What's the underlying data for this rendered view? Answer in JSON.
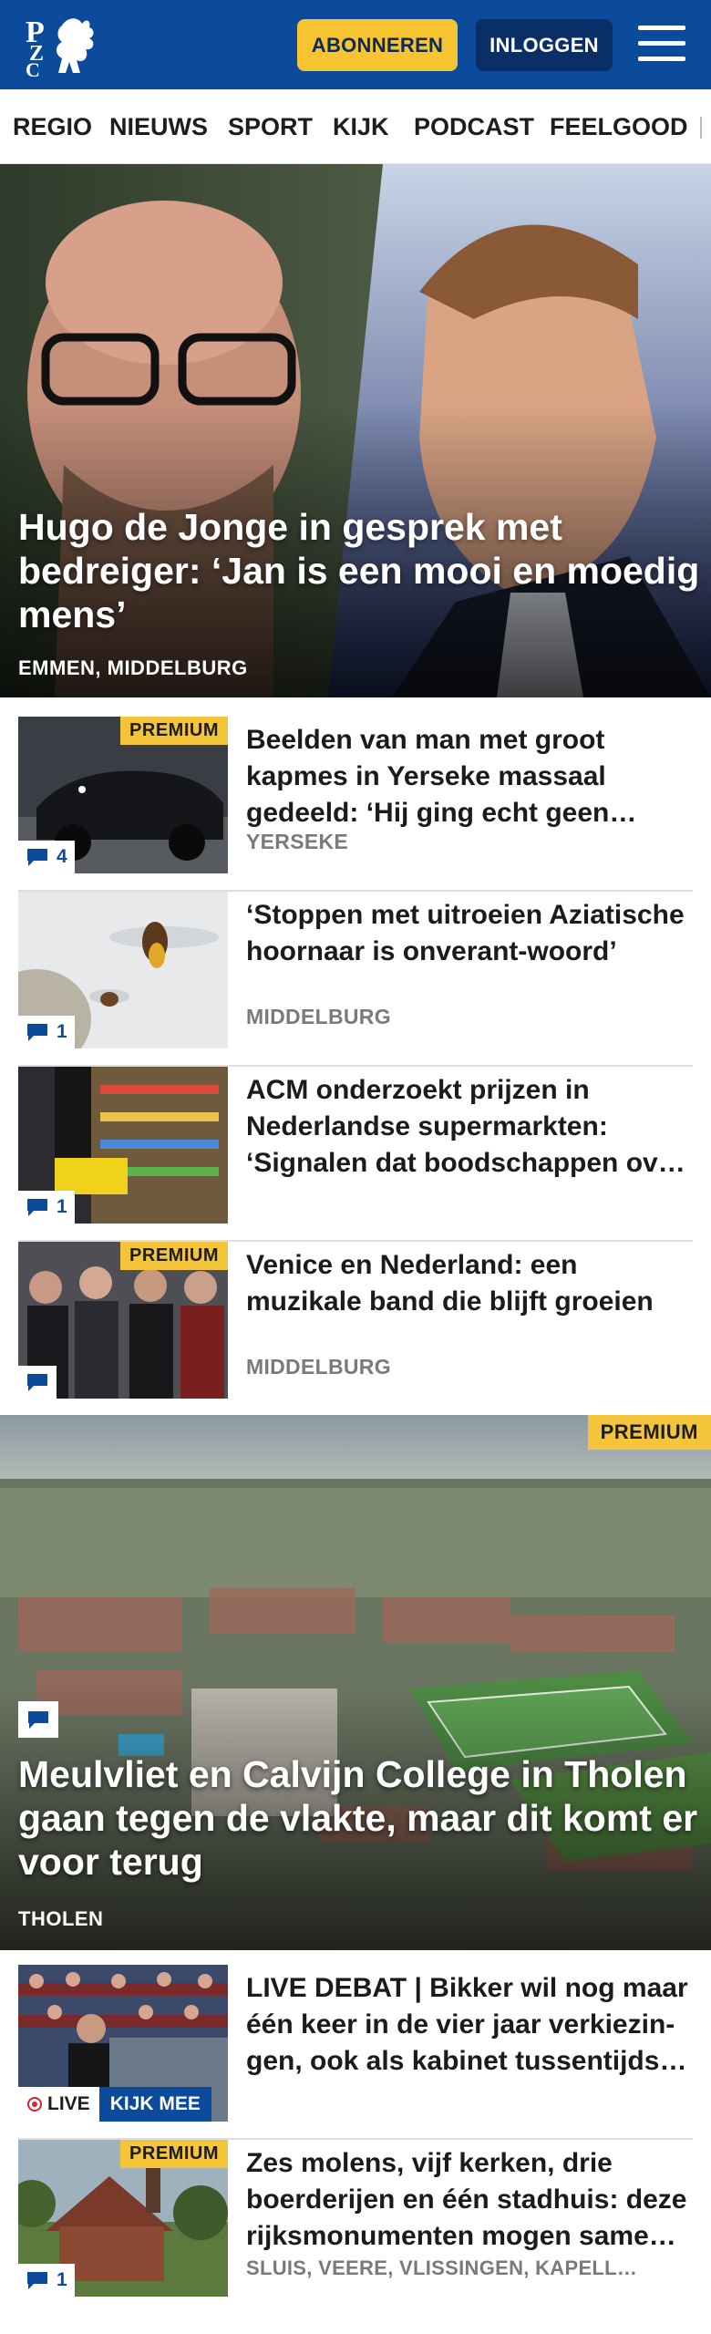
{
  "header": {
    "logo_text": "PZC",
    "subscribe_label": "ABONNEREN",
    "login_label": "INLOGGEN",
    "menu_icon": "hamburger-icon",
    "colors": {
      "brand": "#0c4a9b",
      "subscribe": "#f6c431",
      "login": "#0a2f66",
      "premium": "#f4c43a"
    }
  },
  "nav": {
    "items": [
      "REGIO",
      "NIEUWS",
      "SPORT",
      "KIJK",
      "PODCAST",
      "FEELGOOD"
    ]
  },
  "hero": {
    "title": "Hugo de Jonge in gesprek met bedreiger: ‘Jan is een mooi en moedig mens’",
    "location": "EMMEN, MIDDELBURG"
  },
  "articles": [
    {
      "title": "Beelden van man met groot kapmes in Yerseke massaal gedeeld: ‘Hij ging echt geen…",
      "location": "YERSEKE",
      "premium": "PREMIUM",
      "comments": "4"
    },
    {
      "title": "‘Stoppen met uitroeien Aziatische hoornaar is onverant-woord’",
      "location": "MIDDELBURG",
      "comments": "1"
    },
    {
      "title": "ACM onderzoekt prijzen in Nederlandse supermarkten: ‘Signalen dat boodschappen ov…",
      "comments": "1"
    },
    {
      "title": "Venice en Nederland: een muzikale band die blijft groeien",
      "location": "MIDDELBURG",
      "premium": "PREMIUM",
      "comments": ""
    }
  ],
  "feature": {
    "premium": "PREMIUM",
    "title": "Meulvliet en Calvijn College in Tholen gaan tegen de vlakte, maar dit komt er voor terug",
    "location": "THOLEN"
  },
  "articles2": [
    {
      "title": "LIVE DEBAT | Bikker wil nog maar één keer in de vier jaar verkiezin-gen, ook als kabinet tussentijds…",
      "live_label": "LIVE",
      "watch_label": "KIJK MEE"
    },
    {
      "title": "Zes molens, vijf kerken, drie boerderijen en één stadhuis: deze rijksmonumenten mogen same…",
      "location": "SLUIS, VEERE, VLISSINGEN, KAPELL…",
      "premium": "PREMIUM",
      "comments": "1"
    }
  ]
}
